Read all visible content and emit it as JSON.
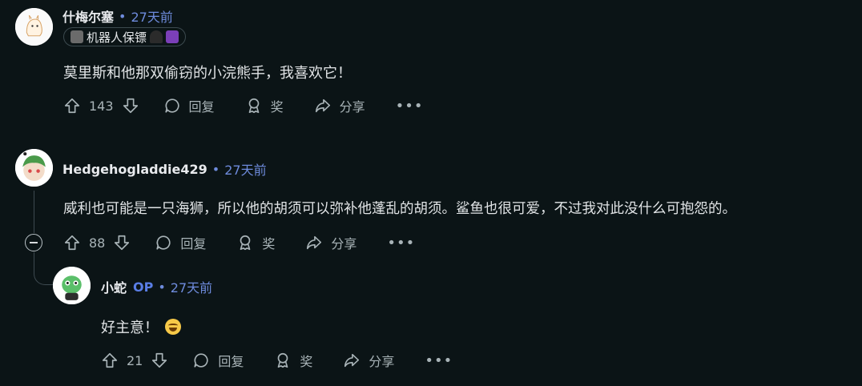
{
  "comments": [
    {
      "username": "什梅尔塞",
      "time": "27天前",
      "flair": "机器人保镖",
      "body": "莫里斯和他那双偷窃的小浣熊手，我喜欢它！",
      "votes": "143",
      "reply_label": "回复",
      "award_label": "奖",
      "share_label": "分享",
      "more_label": "•••"
    },
    {
      "username": "Hedgehogladdie429",
      "time": "27天前",
      "body": "威利也可能是一只海狮，所以他的胡须可以弥补他蓬乱的胡须。鲨鱼也很可爱，不过我对此没什么可抱怨的。",
      "votes": "88",
      "reply_label": "回复",
      "award_label": "奖",
      "share_label": "分享",
      "more_label": "•••"
    },
    {
      "username": "小蛇",
      "op_badge": "OP",
      "time": "27天前",
      "body": "好主意！",
      "votes": "21",
      "reply_label": "回复",
      "award_label": "奖",
      "share_label": "分享",
      "more_label": "•••"
    }
  ],
  "separator": "•",
  "colors": {
    "background": "#0b1416",
    "timestamp": "#6e8bdc",
    "op_badge": "#5a7ee6",
    "text": "#e1e4e6",
    "muted": "#a8b3b7"
  },
  "icons": [
    "upvote-icon",
    "downvote-icon",
    "reply-icon",
    "award-icon",
    "share-icon",
    "more-icon",
    "collapse-icon"
  ]
}
